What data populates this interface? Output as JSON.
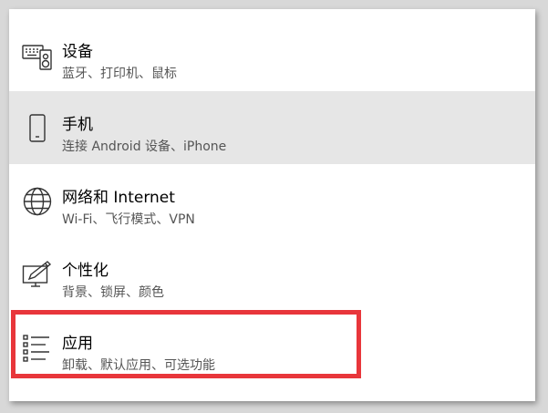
{
  "settings": {
    "items": [
      {
        "title": "设备",
        "subtitle": "蓝牙、打印机、鼠标",
        "icon": "devices-icon"
      },
      {
        "title": "手机",
        "subtitle": "连接 Android 设备、iPhone",
        "icon": "phone-icon"
      },
      {
        "title": "网络和 Internet",
        "subtitle": "Wi-Fi、飞行模式、VPN",
        "icon": "globe-icon"
      },
      {
        "title": "个性化",
        "subtitle": "背景、锁屏、颜色",
        "icon": "personalization-icon"
      },
      {
        "title": "应用",
        "subtitle": "卸载、默认应用、可选功能",
        "icon": "apps-list-icon"
      }
    ],
    "selected_index": 1,
    "highlighted_index": 4
  },
  "colors": {
    "selected_bg": "#e6e6e6",
    "highlight_border": "#e8363b",
    "subtitle_text": "#555555"
  }
}
